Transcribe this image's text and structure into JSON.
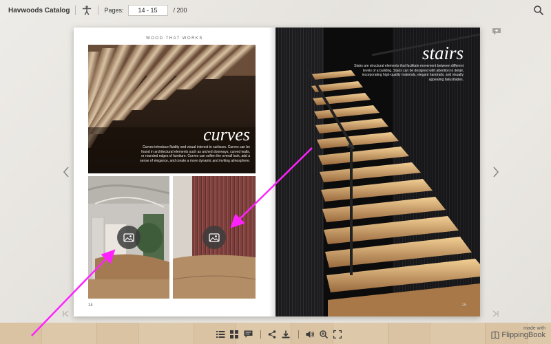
{
  "app": {
    "title": "Havwoods Catalog",
    "pages_label": "Pages:",
    "pages_value": "14 - 15",
    "total_pages": "/ 200"
  },
  "left_page": {
    "header": "WOOD THAT WORKS",
    "title": "curves",
    "body": "Curves introduce fluidity and visual interest to surfaces. Curves can be found in architectural elements such as arched doorways, curved walls, or rounded edges of furniture. Curves can soften the overall look, add a sense of elegance, and create a more dynamic and inviting atmosphere.",
    "page_number": "14"
  },
  "right_page": {
    "title": "stairs",
    "body": "Stairs are structural elements that facilitate movement between different levels of a building. Stairs can be designed with attention to detail, incorporating high-quality materials, elegant handrails, and visually appealing balustrades.",
    "page_number": "15"
  },
  "branding": {
    "made_with": "made with",
    "name": "FlippingBook"
  },
  "icons": {
    "accessibility": "accessibility-icon",
    "search": "search-icon",
    "prev": "chevron-left-icon",
    "next": "chevron-right-icon",
    "first": "first-page-icon",
    "last": "last-page-icon",
    "notes": "notes-icon",
    "photo": "photo-icon"
  },
  "colors": {
    "annotation_arrow": "#ff22ff",
    "floor": "#d9c3a3"
  }
}
